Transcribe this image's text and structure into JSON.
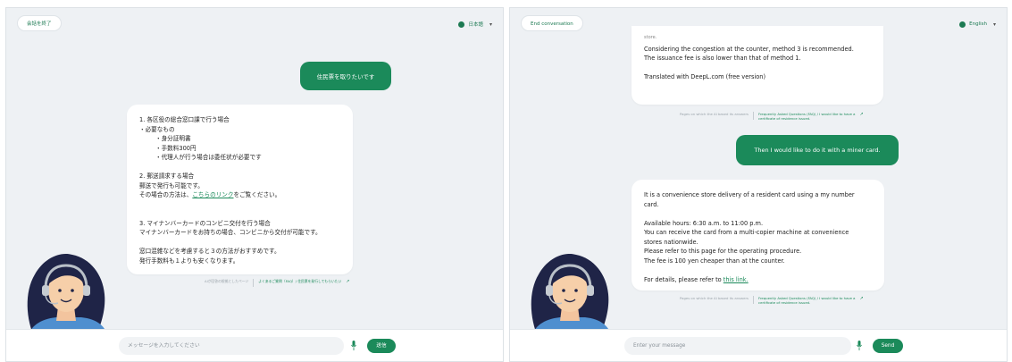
{
  "jp": {
    "end_label": "会話を終了",
    "lang_label": "日本語",
    "user_message": "住民票を取りたいです",
    "bot_lines": [
      "1. 各区役の総合窓口課で行う場合",
      "・必要なもの",
      "・身分証明書",
      "・手数料300円",
      "・代理人が行う場合は委任状が必要です",
      "",
      "2. 郵送請求する場合",
      "郵送で発行も可能です。",
      "その場合の方法は、",
      "こちらのリンク",
      "をご覧ください。",
      "",
      "",
      "3. マイナンバーカードのコンビニ交付を行う場合",
      "マイナンバーカードをお持ちの場合、コンビニから交付が可能です。",
      "",
      "窓口混雑などを考慮すると３の方法がおすすめです。",
      "発行手数料も１よりも安くなります。"
    ],
    "source_label": "AIが回答の根拠としたページ",
    "source_link": "よくあるご質問（FAQ）/ 住民票を発行してもらいたい",
    "input_placeholder": "メッセージを入力してください",
    "send_label": "送信"
  },
  "en": {
    "end_label": "End conversation",
    "lang_label": "English",
    "top_lines": [
      "store.",
      "Considering the congestion at the counter, method 3 is recommended.",
      "The issuance fee is also lower than that of method 1.",
      "",
      "Translated with DeepL.com (free version)"
    ],
    "source_label": "Pages on which the AI based its answers",
    "source_link_1": "Frequently Asked Questions (FAQ) / I would like to have a",
    "source_link_2": "certificate of residence issued.",
    "user_message": "Then I would like to do it with a miner card.",
    "bot_lines": [
      "It is a convenience store delivery of a resident card using a my number",
      "card.",
      "",
      "Available hours: 6:30 a.m. to 11:00 p.m.",
      "You can receive the card from a multi-copier machine at convenience",
      "stores nationwide.",
      "Please refer to this page for the operating procedure.",
      "The fee is 100 yen cheaper than at the counter.",
      "",
      "For details, please refer to",
      "this link."
    ],
    "input_placeholder": "Enter your message",
    "send_label": "Send"
  },
  "colors": {
    "brand_green": "#1b8a5a",
    "panel_bg": "#eef1f4"
  },
  "icons": [
    "globe-icon",
    "chevron-down-icon",
    "external-link-icon",
    "microphone-icon",
    "operator-avatar"
  ]
}
